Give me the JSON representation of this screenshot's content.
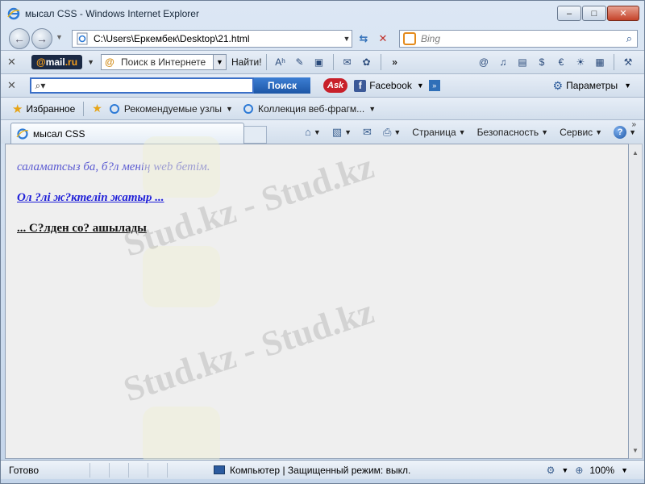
{
  "window": {
    "title": "мысал CSS - Windows Internet Explorer"
  },
  "address": {
    "url": "C:\\Users\\Еркембек\\Desktop\\21.html",
    "search_placeholder": "Bing"
  },
  "toolbar1": {
    "mailru_prefix": "@",
    "mailru_brand": "mail",
    "mailru_tld": ".ru",
    "search_label": "Поиск в Интернете",
    "find_label": "Найти!"
  },
  "toolbar2": {
    "search_button": "Поиск",
    "ask_label": "Ask",
    "facebook_label": "Facebook",
    "params_label": "Параметры"
  },
  "favorites_bar": {
    "favorites": "Избранное",
    "recommended": "Рекомендуемые узлы",
    "webslices": "Коллекция веб-фрагм..."
  },
  "tab": {
    "label": "мысал CSS"
  },
  "command_bar": {
    "page": "Страница",
    "safety": "Безопасность",
    "tools": "Сервис"
  },
  "content": {
    "line1": "саламатсыз ба, б?л менің web бетім.",
    "line2": "Ол ?лі ж?ктеліп жатыр ...",
    "line3": "... С?лден со? ашылады"
  },
  "status": {
    "ready": "Готово",
    "zone": "Компьютер | Защищенный режим: выкл.",
    "zoom": "100%"
  },
  "watermark": {
    "text": "Stud.kz - Stud.kz"
  }
}
